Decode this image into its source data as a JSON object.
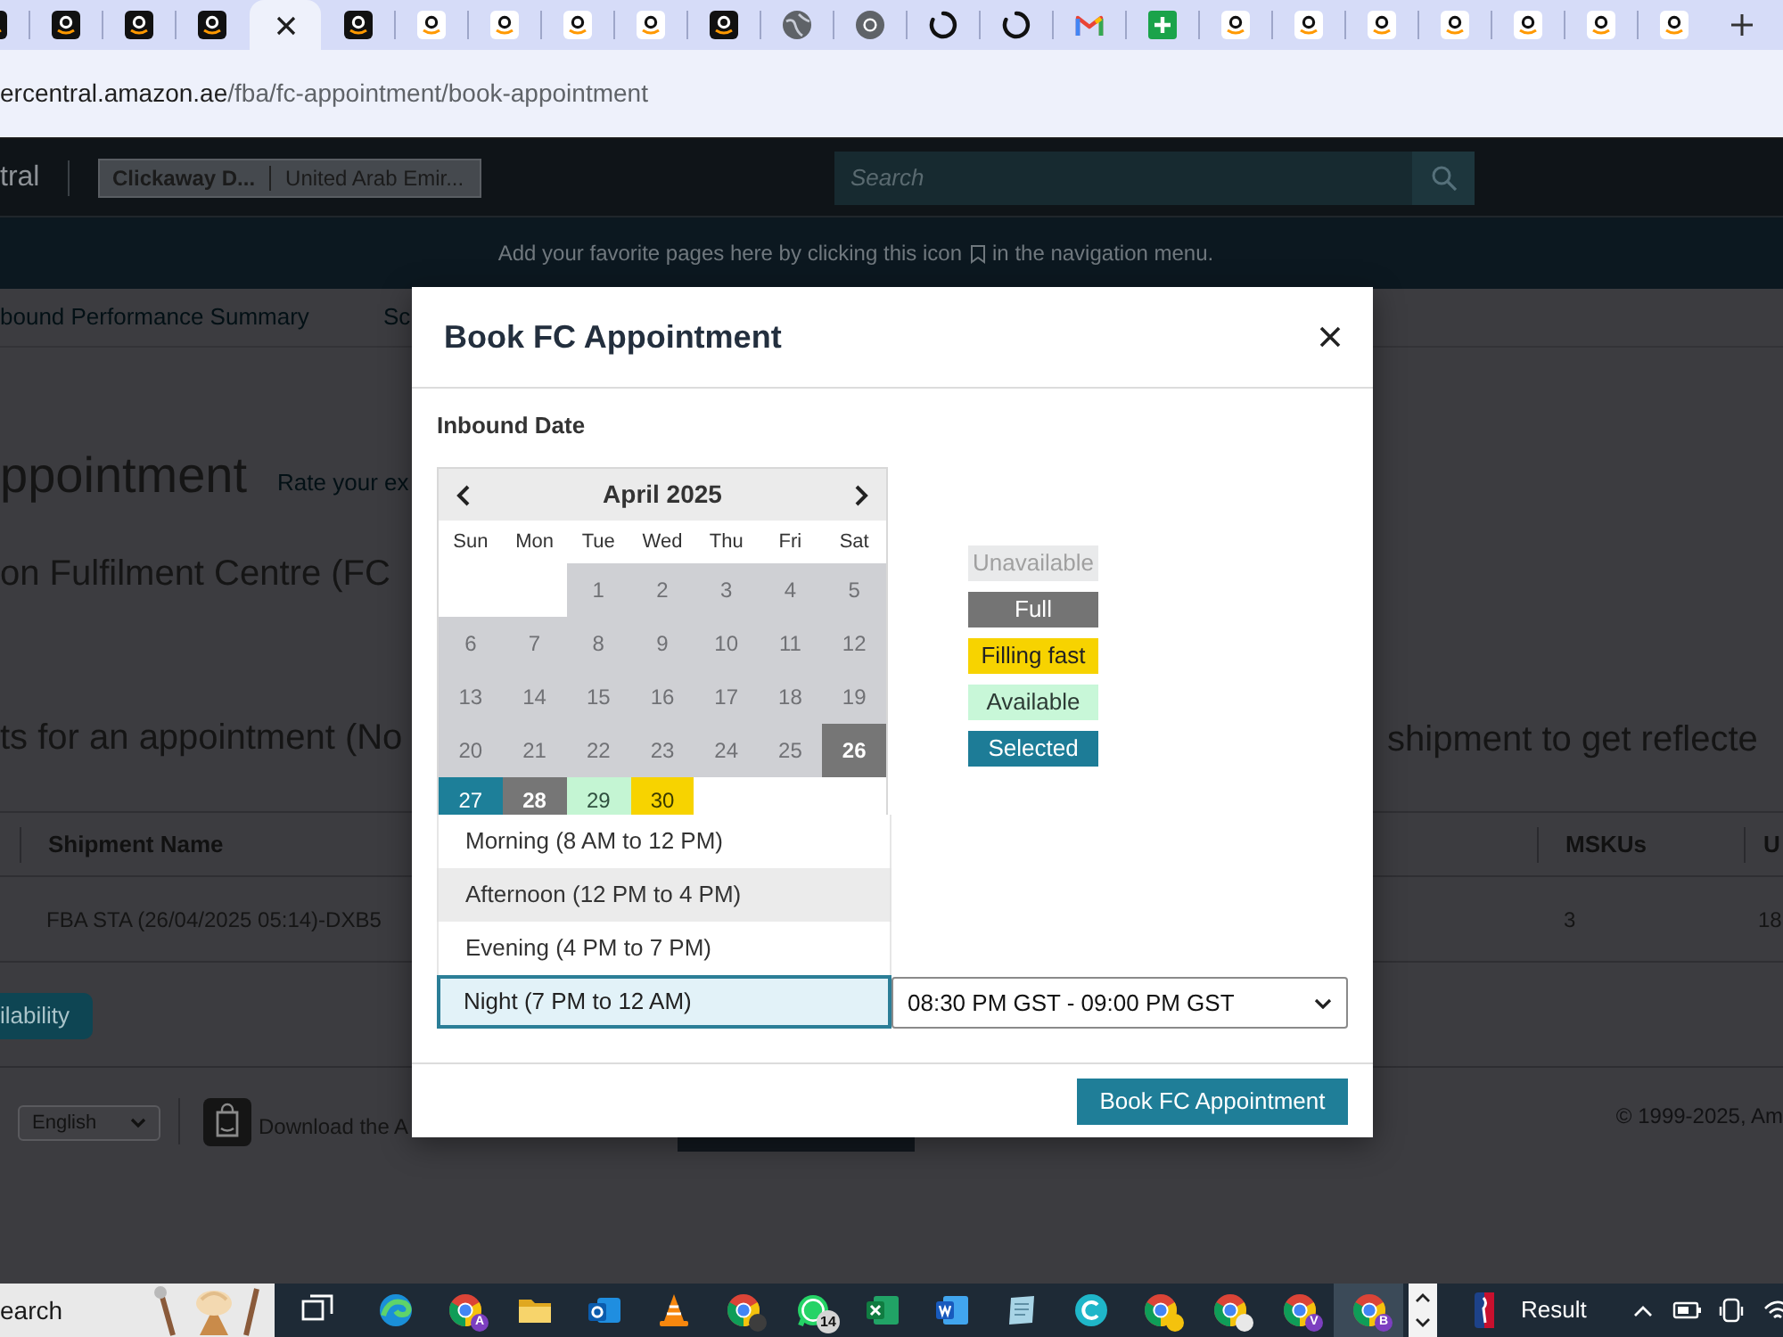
{
  "tabs": [
    {
      "kind": "amazon-dark",
      "selected": false
    },
    {
      "kind": "amazon-dark",
      "selected": false
    },
    {
      "kind": "amazon-dark",
      "selected": false
    },
    {
      "kind": "amazon-dark",
      "selected": false
    },
    {
      "selected": true
    },
    {
      "kind": "amazon-dark",
      "selected": false
    },
    {
      "kind": "amazon-light",
      "selected": false
    },
    {
      "kind": "amazon-light",
      "selected": false
    },
    {
      "kind": "amazon-light",
      "selected": false
    },
    {
      "kind": "amazon-light",
      "selected": false
    },
    {
      "kind": "amazon-dark",
      "selected": false
    },
    {
      "kind": "globe",
      "selected": false
    },
    {
      "kind": "chrome",
      "selected": false
    },
    {
      "kind": "loading",
      "selected": false
    },
    {
      "kind": "loading",
      "selected": false
    },
    {
      "kind": "gmail",
      "selected": false
    },
    {
      "kind": "sheet-plus",
      "selected": false
    },
    {
      "kind": "amazon-light",
      "selected": false
    },
    {
      "kind": "amazon-light",
      "selected": false
    },
    {
      "kind": "amazon-light",
      "selected": false
    },
    {
      "kind": "amazon-light",
      "selected": false
    },
    {
      "kind": "amazon-light",
      "selected": false
    },
    {
      "kind": "amazon-light",
      "selected": false
    },
    {
      "kind": "amazon-light",
      "selected": false
    }
  ],
  "address": {
    "host": "ercentral.amazon.ae",
    "path": "/fba/fc-appointment/book-appointment"
  },
  "seller_header": {
    "logo_fragment": "tral",
    "account": {
      "name": "Clickaway D...",
      "marketplace": "United Arab Emir..."
    },
    "search": {
      "placeholder": "Search"
    }
  },
  "favorites_hint": {
    "before": "Add your favorite pages here by clicking this icon",
    "after": "in the navigation menu."
  },
  "nav_links": [
    "bound Performance Summary",
    "Sc"
  ],
  "page": {
    "heading": "ppointment",
    "rate_link": "Rate your ex",
    "subheading": "on Fulfilment Centre (FC",
    "notice_left": "ts for an appointment (No",
    "notice_right": "shipment to get reflecte",
    "table": {
      "columns": [
        "Shipment Name",
        "MSKUs",
        "U"
      ],
      "rows": [
        [
          "FBA STA (26/04/2025 05:14)-DXB5",
          "3",
          "18"
        ]
      ]
    },
    "action_button": "ilability"
  },
  "footer": {
    "language": "English",
    "app_text": "Download the A",
    "copyright": "© 1999-2025, Am"
  },
  "modal": {
    "title": "Book FC Appointment",
    "section_label": "Inbound Date",
    "calendar": {
      "month": "April 2025",
      "weekdays": [
        "Sun",
        "Mon",
        "Tue",
        "Wed",
        "Thu",
        "Fri",
        "Sat"
      ],
      "weeks": [
        [
          {
            "kind": "blank"
          },
          {
            "kind": "blank"
          },
          {
            "day": "1",
            "kind": "unavailable"
          },
          {
            "day": "2",
            "kind": "unavailable"
          },
          {
            "day": "3",
            "kind": "unavailable"
          },
          {
            "day": "4",
            "kind": "unavailable"
          },
          {
            "day": "5",
            "kind": "unavailable"
          }
        ],
        [
          {
            "day": "6",
            "kind": "unavailable"
          },
          {
            "day": "7",
            "kind": "unavailable"
          },
          {
            "day": "8",
            "kind": "unavailable"
          },
          {
            "day": "9",
            "kind": "unavailable"
          },
          {
            "day": "10",
            "kind": "unavailable"
          },
          {
            "day": "11",
            "kind": "unavailable"
          },
          {
            "day": "12",
            "kind": "unavailable"
          }
        ],
        [
          {
            "day": "13",
            "kind": "unavailable"
          },
          {
            "day": "14",
            "kind": "unavailable"
          },
          {
            "day": "15",
            "kind": "unavailable"
          },
          {
            "day": "16",
            "kind": "unavailable"
          },
          {
            "day": "17",
            "kind": "unavailable"
          },
          {
            "day": "18",
            "kind": "unavailable"
          },
          {
            "day": "19",
            "kind": "unavailable"
          }
        ],
        [
          {
            "day": "20",
            "kind": "unavailable"
          },
          {
            "day": "21",
            "kind": "unavailable"
          },
          {
            "day": "22",
            "kind": "unavailable"
          },
          {
            "day": "23",
            "kind": "unavailable"
          },
          {
            "day": "24",
            "kind": "unavailable"
          },
          {
            "day": "25",
            "kind": "unavailable"
          },
          {
            "day": "26",
            "kind": "full"
          }
        ],
        [
          {
            "day": "27",
            "kind": "selected"
          },
          {
            "day": "28",
            "kind": "full"
          },
          {
            "day": "29",
            "kind": "available"
          },
          {
            "day": "30",
            "kind": "filling_fast"
          },
          {
            "kind": "blank"
          },
          {
            "kind": "blank"
          },
          {
            "kind": "blank"
          }
        ]
      ]
    },
    "legend": [
      {
        "label": "Unavailable",
        "kind": "unavailable"
      },
      {
        "label": "Full",
        "kind": "full"
      },
      {
        "label": "Filling fast",
        "kind": "filling_fast"
      },
      {
        "label": "Available",
        "kind": "available"
      },
      {
        "label": "Selected",
        "kind": "selected"
      }
    ],
    "time_of_day": {
      "options": [
        {
          "label": "Morning (8 AM to 12 PM)",
          "selected": false,
          "hovered": false
        },
        {
          "label": "Afternoon (12 PM to 4 PM)",
          "selected": false,
          "hovered": true
        },
        {
          "label": "Evening (4 PM to 7 PM)",
          "selected": false,
          "hovered": false
        },
        {
          "label": "Night (7 PM to 12 AM)",
          "selected": true,
          "hovered": false
        }
      ]
    },
    "time_slot": {
      "value": "08:30 PM GST - 09:00 PM GST"
    },
    "submit": "Book FC Appointment"
  },
  "taskbar": {
    "search": {
      "placeholder": "earch"
    },
    "apps": [
      {
        "kind": "task-view",
        "active": false
      },
      {
        "kind": "edge",
        "active": false
      },
      {
        "kind": "chrome",
        "badge": "A",
        "active": false
      },
      {
        "kind": "folder",
        "active": false
      },
      {
        "kind": "outlook",
        "active": false
      },
      {
        "kind": "vlc",
        "active": false
      },
      {
        "kind": "chrome",
        "color": "#3d3d3d",
        "active": false
      },
      {
        "kind": "whatsapp",
        "badge": "14",
        "active": false
      },
      {
        "kind": "excel",
        "active": false
      },
      {
        "kind": "word",
        "active": false
      },
      {
        "kind": "notepad",
        "active": false
      },
      {
        "kind": "canva",
        "active": false
      },
      {
        "kind": "chrome",
        "color": "#f4c20d",
        "active": false
      },
      {
        "kind": "chrome",
        "color": "#e8e8e8",
        "active": false
      },
      {
        "kind": "chrome",
        "badge": "V",
        "active": false
      },
      {
        "kind": "chrome",
        "badge": "B",
        "active": true
      }
    ],
    "news": "Result"
  }
}
